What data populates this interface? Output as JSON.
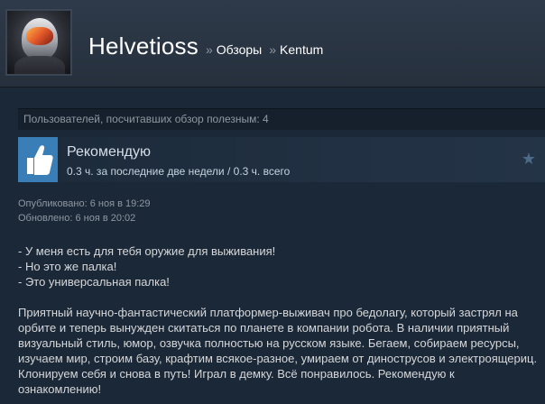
{
  "header": {
    "user_name": "Helvetioss",
    "separator_1": "»",
    "crumb_reviews": "Обзоры",
    "separator_2": "»",
    "crumb_game": "Kentum"
  },
  "helpful": {
    "text": "Пользователей, посчитавших обзор полезным: 4"
  },
  "recommendation": {
    "label": "Рекомендую",
    "hours": "0.3 ч. за последние две недели / 0.3 ч. всего",
    "icon": "thumbs-up-icon",
    "star_icon": "star-icon",
    "accent_color": "#3a7eb8"
  },
  "dates": {
    "published": "Опубликовано: 6 ноя в 19:29",
    "updated": "Обновлено: 6 ноя в 20:02"
  },
  "review": {
    "quote_lines": [
      "- У меня есть для тебя оружие для выживания!",
      "- Но это же палка!",
      "- Это универсальная палка!"
    ],
    "body": "Приятный научно-фантастический платформер-выживач про бедолагу, который застрял на орбите и теперь вынужден скитаться по планете в компании робота. В наличии приятный визуальный стиль, юмор, озвучка полностью на русском языке. Бегаем, собираем ресурсы, изучаем мир, строим базу, крафтим всякое-разное, умираем от динострусов и электроящериц. Клонируем себя и снова в путь! Играл в демку. Всё понравилось. Рекомендую к ознакомлению!"
  }
}
